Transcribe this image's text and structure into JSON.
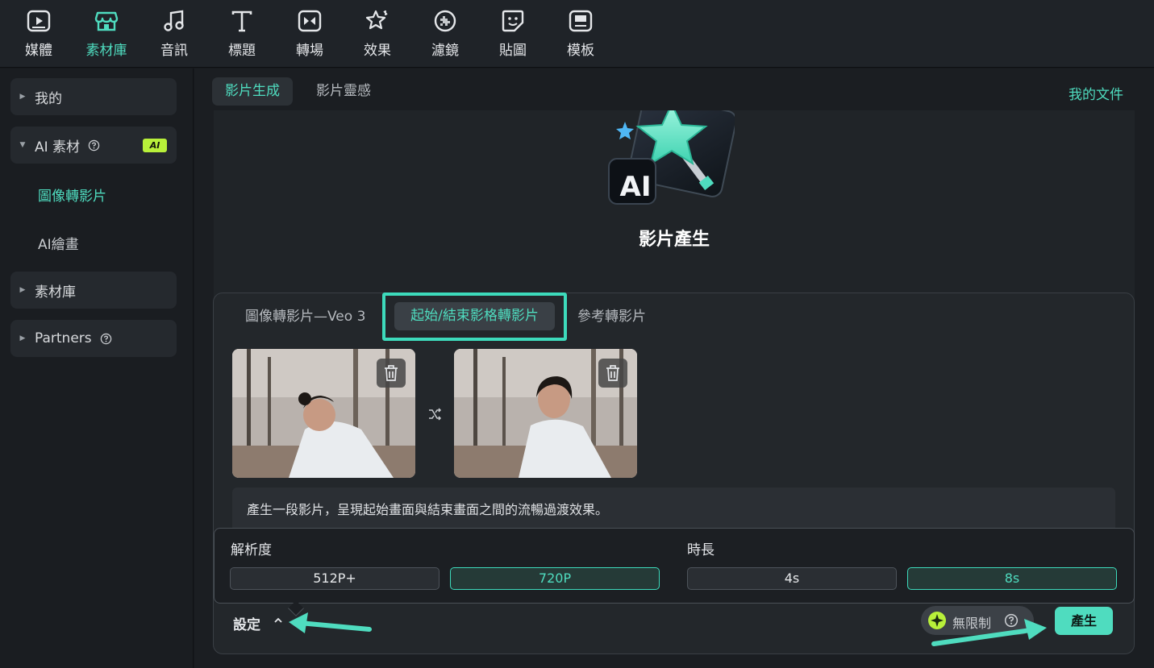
{
  "toolbar": {
    "items": [
      {
        "label": "媒體",
        "icon": "media-icon"
      },
      {
        "label": "素材庫",
        "icon": "store-icon",
        "active": true
      },
      {
        "label": "音訊",
        "icon": "music-note-icon"
      },
      {
        "label": "標題",
        "icon": "title-t-icon"
      },
      {
        "label": "轉場",
        "icon": "transition-icon"
      },
      {
        "label": "效果",
        "icon": "effects-star-icon"
      },
      {
        "label": "濾鏡",
        "icon": "filter-icon"
      },
      {
        "label": "貼圖",
        "icon": "sticker-icon"
      },
      {
        "label": "模板",
        "icon": "template-icon"
      }
    ]
  },
  "sidebar": {
    "my": "我的",
    "ai_assets": "AI 素材",
    "ai_badge": "AI",
    "image_to_video": "圖像轉影片",
    "ai_painting": "AI繪畫",
    "stock": "素材庫",
    "partners": "Partners"
  },
  "main": {
    "tab_generate": "影片生成",
    "tab_inspiration": "影片靈感",
    "my_docs": "我的文件",
    "hero_badge": "AI",
    "hero_title": "影片產生",
    "subtab_veo3": "圖像轉影片—Veo 3",
    "subtab_startend": "起始/結束影格轉影片",
    "subtab_reference": "參考轉影片",
    "prompt": "產生一段影片，呈現起始畫面與結束畫面之間的流暢過渡效果。",
    "resolution_label": "解析度",
    "duration_label": "時長",
    "resolution_options": [
      "512P+",
      "720P"
    ],
    "duration_options": [
      "4s",
      "8s"
    ],
    "settings_label": "設定",
    "unlimited_label": "無限制",
    "generate_button": "產生"
  },
  "colors": {
    "accent": "#4fdcbf",
    "highlight_box": "#3ddbbc",
    "ai_badge": "#b8f03a"
  }
}
